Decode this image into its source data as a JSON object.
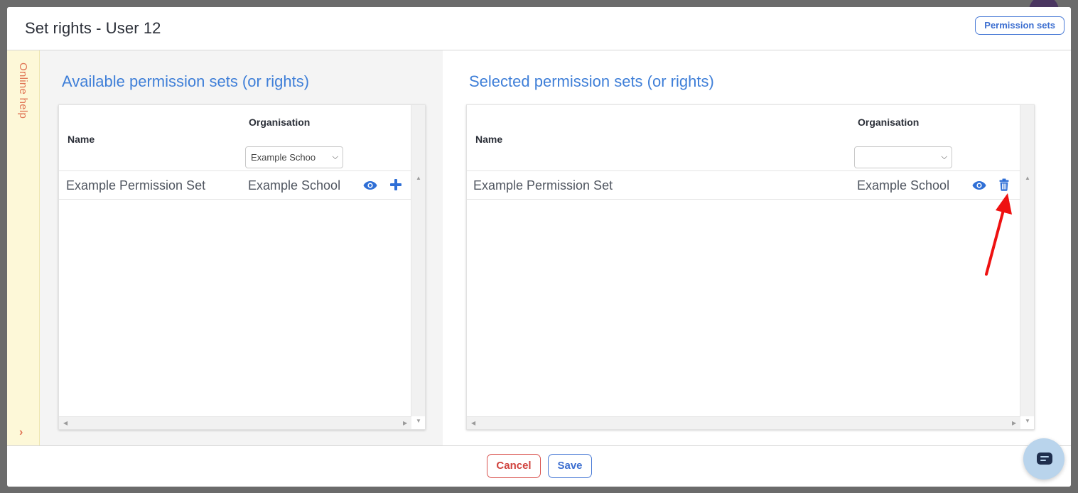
{
  "dialog": {
    "title": "Set rights - User 12",
    "permission_sets_button": "Permission sets"
  },
  "help": {
    "label": "Online help",
    "expand_glyph": "›"
  },
  "available": {
    "heading": "Available permission sets (or rights)",
    "columns": {
      "name": "Name",
      "organisation": "Organisation"
    },
    "org_filter_value": "Example Schoo",
    "rows": [
      {
        "name": "Example Permission Set",
        "organisation": "Example School",
        "view_icon": "eye-icon",
        "action_icon": "plus-icon"
      }
    ]
  },
  "selected": {
    "heading": "Selected permission sets (or rights)",
    "columns": {
      "name": "Name",
      "organisation": "Organisation"
    },
    "org_filter_value": "",
    "rows": [
      {
        "name": "Example Permission Set",
        "organisation": "Example School",
        "view_icon": "eye-icon",
        "action_icon": "trash-icon"
      }
    ]
  },
  "footer": {
    "cancel_label": "Cancel",
    "save_label": "Save"
  },
  "colors": {
    "accent": "#3f7fd8",
    "danger": "#d9534f",
    "help_rail_bg": "#fdf8d8",
    "annotation_arrow": "#ee1111"
  },
  "chat": {
    "icon": "chat-icon"
  }
}
